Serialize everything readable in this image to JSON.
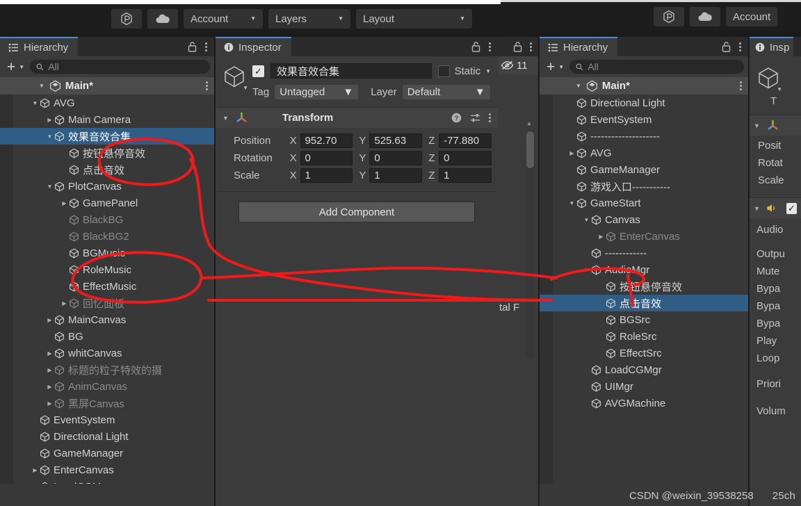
{
  "toolbar_left": {
    "services_icon": "unity-services-icon",
    "cloud_icon": "cloud-icon",
    "account": "Account",
    "layers": "Layers",
    "layout": "Layout"
  },
  "toolbar_right": {
    "services_icon": "unity-services-icon",
    "cloud_icon": "cloud-icon",
    "account": "Account"
  },
  "left_hierarchy": {
    "tab_label": "Hierarchy",
    "search_placeholder": "All",
    "scene_name": "Main*",
    "rows": [
      {
        "label": "AVG",
        "depth": 1,
        "arrow": "open",
        "dim": false,
        "selected": false
      },
      {
        "label": "Main Camera",
        "depth": 2,
        "arrow": "closed",
        "dim": false,
        "selected": false
      },
      {
        "label": "效果音效合集",
        "depth": 2,
        "arrow": "open",
        "dim": false,
        "selected": true
      },
      {
        "label": "按钮悬停音效",
        "depth": 3,
        "arrow": "none",
        "dim": false,
        "selected": false
      },
      {
        "label": "点击音效",
        "depth": 3,
        "arrow": "none",
        "dim": false,
        "selected": false
      },
      {
        "label": "PlotCanvas",
        "depth": 2,
        "arrow": "open",
        "dim": false,
        "selected": false
      },
      {
        "label": "GamePanel",
        "depth": 3,
        "arrow": "closed",
        "dim": false,
        "selected": false
      },
      {
        "label": "BlackBG",
        "depth": 3,
        "arrow": "none",
        "dim": true,
        "selected": false
      },
      {
        "label": "BlackBG2",
        "depth": 3,
        "arrow": "none",
        "dim": true,
        "selected": false
      },
      {
        "label": "BGMusic",
        "depth": 3,
        "arrow": "none",
        "dim": false,
        "selected": false
      },
      {
        "label": "RoleMusic",
        "depth": 3,
        "arrow": "none",
        "dim": false,
        "selected": false
      },
      {
        "label": "EffectMusic",
        "depth": 3,
        "arrow": "none",
        "dim": false,
        "selected": false
      },
      {
        "label": "回忆面板",
        "depth": 3,
        "arrow": "closed",
        "dim": true,
        "selected": false
      },
      {
        "label": "MainCanvas",
        "depth": 2,
        "arrow": "closed",
        "dim": false,
        "selected": false
      },
      {
        "label": "BG",
        "depth": 2,
        "arrow": "none",
        "dim": false,
        "selected": false
      },
      {
        "label": "whitCanvas",
        "depth": 2,
        "arrow": "closed",
        "dim": false,
        "selected": false
      },
      {
        "label": "标题的粒子特效的摄",
        "depth": 2,
        "arrow": "closed",
        "dim": true,
        "selected": false
      },
      {
        "label": "AnimCanvas",
        "depth": 2,
        "arrow": "closed",
        "dim": true,
        "selected": false
      },
      {
        "label": "黑屏Canvas",
        "depth": 2,
        "arrow": "closed",
        "dim": true,
        "selected": false
      },
      {
        "label": "EventSystem",
        "depth": 1,
        "arrow": "none",
        "dim": false,
        "selected": false
      },
      {
        "label": "Directional Light",
        "depth": 1,
        "arrow": "none",
        "dim": false,
        "selected": false
      },
      {
        "label": "GameManager",
        "depth": 1,
        "arrow": "none",
        "dim": false,
        "selected": false
      },
      {
        "label": "EnterCanvas",
        "depth": 1,
        "arrow": "closed",
        "dim": false,
        "selected": false
      },
      {
        "label": "LoadCGManager",
        "depth": 1,
        "arrow": "none",
        "dim": false,
        "selected": false
      }
    ]
  },
  "inspector": {
    "tab_label": "Inspector",
    "object_name": "效果音效合集",
    "enabled": true,
    "static_label": "Static",
    "static_checked": false,
    "tag_label": "Tag",
    "tag_value": "Untagged",
    "layer_label": "Layer",
    "layer_value": "Default",
    "transform": {
      "title": "Transform",
      "position_label": "Position",
      "rotation_label": "Rotation",
      "scale_label": "Scale",
      "axis_x": "X",
      "axis_y": "Y",
      "axis_z": "Z",
      "position": {
        "x": "952.70",
        "y": "525.63",
        "z": "-77.880"
      },
      "rotation": {
        "x": "0",
        "y": "0",
        "z": "0"
      },
      "scale": {
        "x": "1",
        "y": "1",
        "z": "1"
      }
    },
    "add_component": "Add Component"
  },
  "scene_sliver": {
    "hidden_count": "11",
    "eye_icon": "eye-off-icon",
    "partial_text": "tal F"
  },
  "right_hierarchy": {
    "tab_label": "Hierarchy",
    "search_placeholder": "All",
    "scene_name": "Main*",
    "rows": [
      {
        "label": "Directional Light",
        "depth": 1,
        "arrow": "none",
        "dim": false,
        "selected": false
      },
      {
        "label": "EventSystem",
        "depth": 1,
        "arrow": "none",
        "dim": false,
        "selected": false
      },
      {
        "label": "--------------------",
        "depth": 1,
        "arrow": "none",
        "dim": false,
        "selected": false
      },
      {
        "label": "AVG",
        "depth": 1,
        "arrow": "closed",
        "dim": false,
        "selected": false
      },
      {
        "label": "GameManager",
        "depth": 1,
        "arrow": "none",
        "dim": false,
        "selected": false
      },
      {
        "label": "游戏入口-----------",
        "depth": 1,
        "arrow": "none",
        "dim": false,
        "selected": false
      },
      {
        "label": "GameStart",
        "depth": 1,
        "arrow": "open",
        "dim": false,
        "selected": false
      },
      {
        "label": "Canvas",
        "depth": 2,
        "arrow": "open",
        "dim": false,
        "selected": false
      },
      {
        "label": "EnterCanvas",
        "depth": 3,
        "arrow": "closed",
        "dim": true,
        "selected": false
      },
      {
        "label": "------------",
        "depth": 2,
        "arrow": "none",
        "dim": false,
        "selected": false
      },
      {
        "label": "AudioMgr",
        "depth": 2,
        "arrow": "open",
        "dim": false,
        "selected": false
      },
      {
        "label": "按钮悬停音效",
        "depth": 3,
        "arrow": "none",
        "dim": false,
        "selected": false
      },
      {
        "label": "点击音效",
        "depth": 3,
        "arrow": "none",
        "dim": false,
        "selected": true
      },
      {
        "label": "BGSrc",
        "depth": 3,
        "arrow": "none",
        "dim": false,
        "selected": false
      },
      {
        "label": "RoleSrc",
        "depth": 3,
        "arrow": "none",
        "dim": false,
        "selected": false
      },
      {
        "label": "EffectSrc",
        "depth": 3,
        "arrow": "none",
        "dim": false,
        "selected": false
      },
      {
        "label": "LoadCGMgr",
        "depth": 2,
        "arrow": "none",
        "dim": false,
        "selected": false
      },
      {
        "label": "UIMgr",
        "depth": 2,
        "arrow": "none",
        "dim": false,
        "selected": false
      },
      {
        "label": "AVGMachine",
        "depth": 2,
        "arrow": "none",
        "dim": false,
        "selected": false
      }
    ]
  },
  "right_inspector": {
    "tab_label": "Insp",
    "tag_partial": "T",
    "transform_rows": [
      "Posit",
      "Rotat",
      "Scale"
    ],
    "audio_rows": [
      "Audio",
      "Outpu",
      "Mute",
      "Bypa",
      "Bypa",
      "Bypa",
      "Play",
      "Loop",
      "Priori",
      "Volum"
    ],
    "audio_icon": "speaker-icon"
  },
  "watermark": {
    "text_left": "CSDN @weixin_39538258",
    "text_right": "25ch"
  },
  "colors": {
    "panel_bg": "#383838",
    "panel_alt": "#3b3b3b",
    "selection_blue": "#2f5d86",
    "tab_accent": "#4a8fd4",
    "annotation_red": "#f01a1a"
  }
}
